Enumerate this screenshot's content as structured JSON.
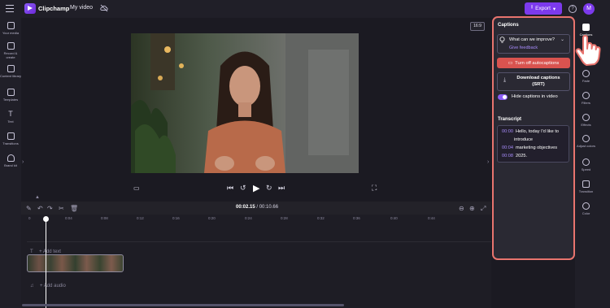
{
  "topbar": {
    "brand": "Clipchamp",
    "project_title": "My video",
    "export_label": "Export",
    "help_label": "?",
    "avatar_initial": "M"
  },
  "left_sidebar": {
    "items": [
      {
        "label": "Your media",
        "icon": "media-icon"
      },
      {
        "label": "Record & create",
        "icon": "camera-icon"
      },
      {
        "label": "Content library",
        "icon": "library-icon"
      },
      {
        "label": "Templates",
        "icon": "templates-icon"
      },
      {
        "label": "Text",
        "icon": "text-icon"
      },
      {
        "label": "Transitions",
        "icon": "transitions-icon"
      },
      {
        "label": "Brand kit",
        "icon": "brand-kit-icon"
      }
    ]
  },
  "preview": {
    "aspect_ratio": "16:9"
  },
  "timeline": {
    "current_time": "00:02.15",
    "total_time": "00:10.66",
    "ticks": [
      "0",
      "0:04",
      "0:08",
      "0:12",
      "0:16",
      "0:20",
      "0:24",
      "0:28",
      "0:32",
      "0:36",
      "0:40",
      "0:44"
    ],
    "add_text_label": "+ Add text",
    "add_audio_label": "+ Add audio"
  },
  "captions_panel": {
    "title": "Captions",
    "feedback_question": "What can we improve?",
    "feedback_link": "Give feedback",
    "turn_off_label": "Turn off autocaptions",
    "download_label": "Download captions (SRT)",
    "hide_toggle_label": "Hide captions in video",
    "hide_toggle_on": true,
    "transcript_title": "Transcript",
    "transcript": [
      {
        "time": "00:00",
        "text": "Hello, today I'd like to"
      },
      {
        "time": "",
        "text": "introduce"
      },
      {
        "time": "00:04",
        "text": "marketing objectives"
      },
      {
        "time": "00:08",
        "text": "2025."
      }
    ]
  },
  "right_sidebar": {
    "items": [
      {
        "label": "Captions",
        "icon": "captions-icon",
        "active": true
      },
      {
        "label": "Fade",
        "icon": "fade-icon"
      },
      {
        "label": "Filters",
        "icon": "filters-icon"
      },
      {
        "label": "Effects",
        "icon": "effects-icon"
      },
      {
        "label": "Adjust colors",
        "icon": "adjust-colors-icon"
      },
      {
        "label": "Speed",
        "icon": "speed-icon"
      },
      {
        "label": "Transition",
        "icon": "transition-icon"
      },
      {
        "label": "Color",
        "icon": "color-icon"
      }
    ]
  },
  "colors": {
    "accent": "#7c3aed",
    "highlight_border": "#e8746e",
    "danger_button": "#d9534f",
    "timestamp": "#a78bfa"
  }
}
